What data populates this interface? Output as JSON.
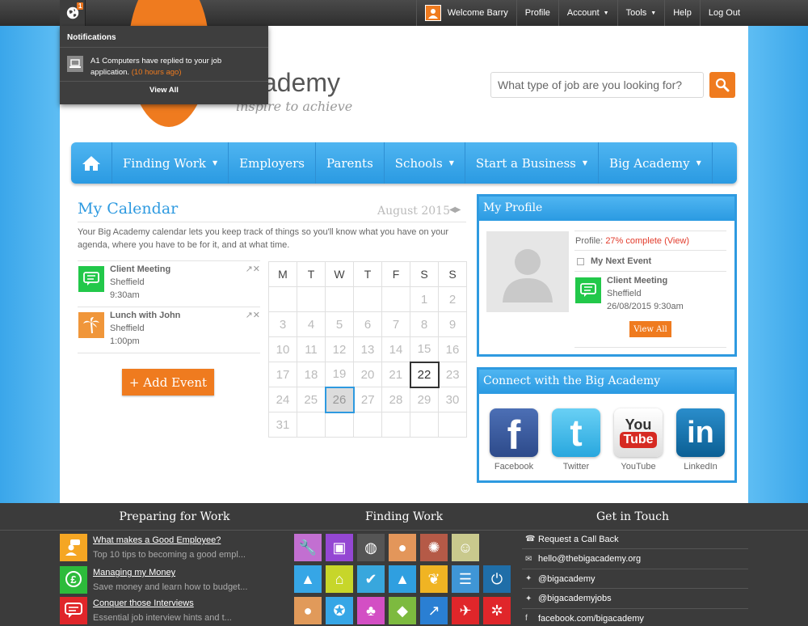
{
  "topbar": {
    "notification_count": "1",
    "welcome": "Welcome Barry",
    "profile": "Profile",
    "account": "Account",
    "tools": "Tools",
    "help": "Help",
    "logout": "Log Out"
  },
  "notifications": {
    "title": "Notifications",
    "item_text": "A1 Computers have replied to your job application.",
    "item_time": "(10 hours ago)",
    "view_all": "View All"
  },
  "logo": {
    "text": "ademy",
    "tagline": "inspire to achieve"
  },
  "search": {
    "placeholder": "What type of job are you looking for?"
  },
  "mainnav": {
    "finding_work": "Finding Work",
    "employers": "Employers",
    "parents": "Parents",
    "schools": "Schools",
    "start_business": "Start a Business",
    "big_academy": "Big Academy"
  },
  "calendar": {
    "title": "My Calendar",
    "month": "August 2015",
    "description": "Your Big Academy calendar lets you keep track of things so you'll know what you have on your agenda, where you have to be for it, and at what time.",
    "events": [
      {
        "title": "Client Meeting",
        "location": "Sheffield",
        "time": "9:30am",
        "color": "#22c84a"
      },
      {
        "title": "Lunch with John",
        "location": "Sheffield",
        "time": "1:00pm",
        "color": "#f0963a"
      }
    ],
    "add_event": "+ Add Event",
    "weekdays": [
      "M",
      "T",
      "W",
      "T",
      "F",
      "S",
      "S"
    ],
    "weeks": [
      [
        "",
        "",
        "",
        "",
        "",
        "1",
        "2"
      ],
      [
        "3",
        "4",
        "5",
        "6",
        "7",
        "8",
        "9"
      ],
      [
        "10",
        "11",
        "12",
        "13",
        "14",
        "15",
        "16"
      ],
      [
        "17",
        "18",
        "19",
        "20",
        "21",
        "22",
        "23"
      ],
      [
        "24",
        "25",
        "26",
        "27",
        "28",
        "29",
        "30"
      ],
      [
        "31",
        "",
        "",
        "",
        "",
        "",
        ""
      ]
    ],
    "today": "22",
    "selected": "26"
  },
  "profile": {
    "title": "My Profile",
    "progress_label": "Profile:",
    "progress_value": "27% complete",
    "progress_link": "(View)",
    "next_event_label": "My Next Event",
    "event_title": "Client Meeting",
    "event_location": "Sheffield",
    "event_datetime": "26/08/2015 9:30am",
    "view_all": "View All"
  },
  "connect": {
    "title": "Connect with the Big Academy",
    "networks": [
      {
        "name": "Facebook",
        "color": "#3b5998"
      },
      {
        "name": "Twitter",
        "color": "#34b7e8"
      },
      {
        "name": "YouTube",
        "color": "#f2f2f2"
      },
      {
        "name": "LinkedIn",
        "color": "#0e6fa8"
      }
    ]
  },
  "footer": {
    "preparing_title": "Preparing for Work",
    "finding_title": "Finding Work",
    "touch_title": "Get in Touch",
    "preparing_items": [
      {
        "title": "What makes a Good Employee?",
        "subtitle": "Top 10 tips to becoming a good empl...",
        "color": "#f5a623"
      },
      {
        "title": "Managing my Money",
        "subtitle": "Save money and learn how to budget...",
        "color": "#2dbb3b"
      },
      {
        "title": "Conquer those Interviews",
        "subtitle": "Essential job interview hints and t...",
        "color": "#e0262a"
      }
    ],
    "tiles": [
      {
        "icon": "wrench-icon",
        "color": "#c26fd1"
      },
      {
        "icon": "briefcase-icon",
        "color": "#9447d3"
      },
      {
        "icon": "globe-icon",
        "color": "#555555"
      },
      {
        "icon": "person-icon",
        "color": "#e3965a"
      },
      {
        "icon": "gears-icon",
        "color": "#b55a47"
      },
      {
        "icon": "smiley-icon",
        "color": "#c9c98d"
      },
      {
        "icon": "",
        "color": ""
      },
      {
        "icon": "",
        "color": ""
      },
      {
        "icon": "graduation-icon",
        "color": "#36a6e6"
      },
      {
        "icon": "house-icon",
        "color": "#c7d62a"
      },
      {
        "icon": "check-icon",
        "color": "#38a7dd"
      },
      {
        "icon": "graduation-icon",
        "color": "#2f9fe0"
      },
      {
        "icon": "leaf-icon",
        "color": "#f0b423"
      },
      {
        "icon": "document-icon",
        "color": "#3f96d6"
      },
      {
        "icon": "power-icon",
        "color": "#1f6ea8"
      },
      {
        "icon": "",
        "color": ""
      },
      {
        "icon": "person-icon",
        "color": "#e19a5a"
      },
      {
        "icon": "police-icon",
        "color": "#36a6e6"
      },
      {
        "icon": "cat-icon",
        "color": "#d34fc4"
      },
      {
        "icon": "tag-icon",
        "color": "#7dba3f"
      },
      {
        "icon": "chart-icon",
        "color": "#2a7fd3"
      },
      {
        "icon": "snowboard-icon",
        "color": "#e0262a"
      },
      {
        "icon": "atom-icon",
        "color": "#e0262a"
      },
      {
        "icon": "",
        "color": ""
      }
    ],
    "contact": [
      {
        "icon": "phone-icon",
        "text": "Request a Call Back"
      },
      {
        "icon": "mail-icon",
        "text": "hello@thebigacademy.org"
      },
      {
        "icon": "twitter-icon",
        "text": "@bigacademy"
      },
      {
        "icon": "twitter-icon",
        "text": "@bigacademyjobs"
      },
      {
        "icon": "facebook-icon",
        "text": "facebook.com/bigacademy"
      }
    ]
  }
}
